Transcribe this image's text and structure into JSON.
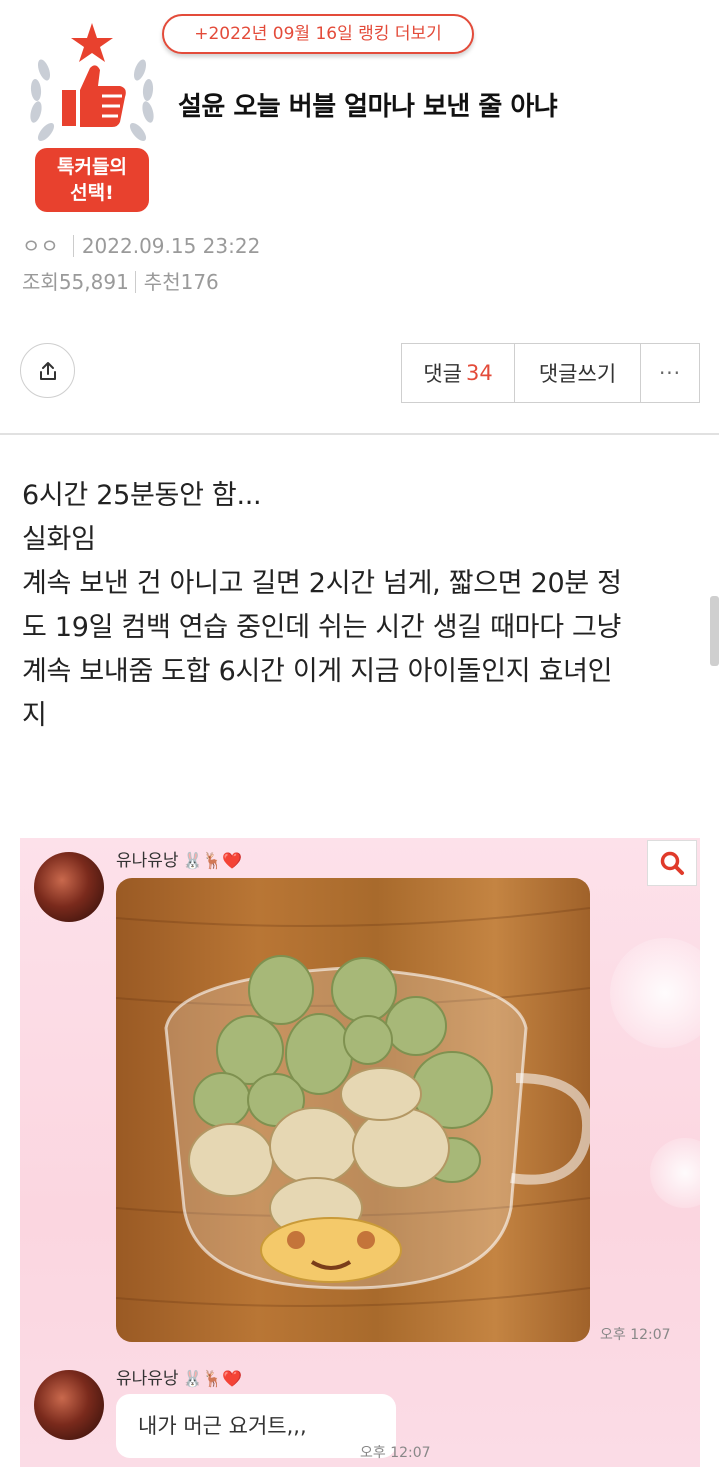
{
  "badge": {
    "label_line1": "톡커들의",
    "label_line2": "선택!"
  },
  "ranking_link": "+2022년 09월 16일 랭킹 더보기",
  "title": "설윤 오늘 버블 얼마나 보낸 줄 아냐",
  "meta": {
    "author": "ㅇㅇ",
    "datetime": "2022.09.15 23:22",
    "views_label": "조회",
    "views": "55,891",
    "recommend_label": "추천",
    "recommend": "176"
  },
  "actions": {
    "comment_label": "댓글",
    "comment_count": "34",
    "write_comment_label": "댓글쓰기",
    "more_label": "···"
  },
  "body_lines": [
    "6시간 25분동안 함...",
    "실화임",
    "계속 보낸 건 아니고 길면 2시간 넘게, 짧으면 20분 정",
    "도 19일 컴백 연습 중인데 쉬는 시간 생길 때마다 그냥",
    "계속 보내줌 도합 6시간 이게 지금 아이돌인지 효녀인",
    "지"
  ],
  "chat": {
    "sender_name": "유나유낭",
    "sender_emojis": "🐰🦌❤️",
    "photo_time": "오후 12:07",
    "message_text": "내가 머근 요거트,,,",
    "message_time": "오후 12:07"
  },
  "colors": {
    "accent": "#e34b3a",
    "badge_red": "#e8412e"
  }
}
